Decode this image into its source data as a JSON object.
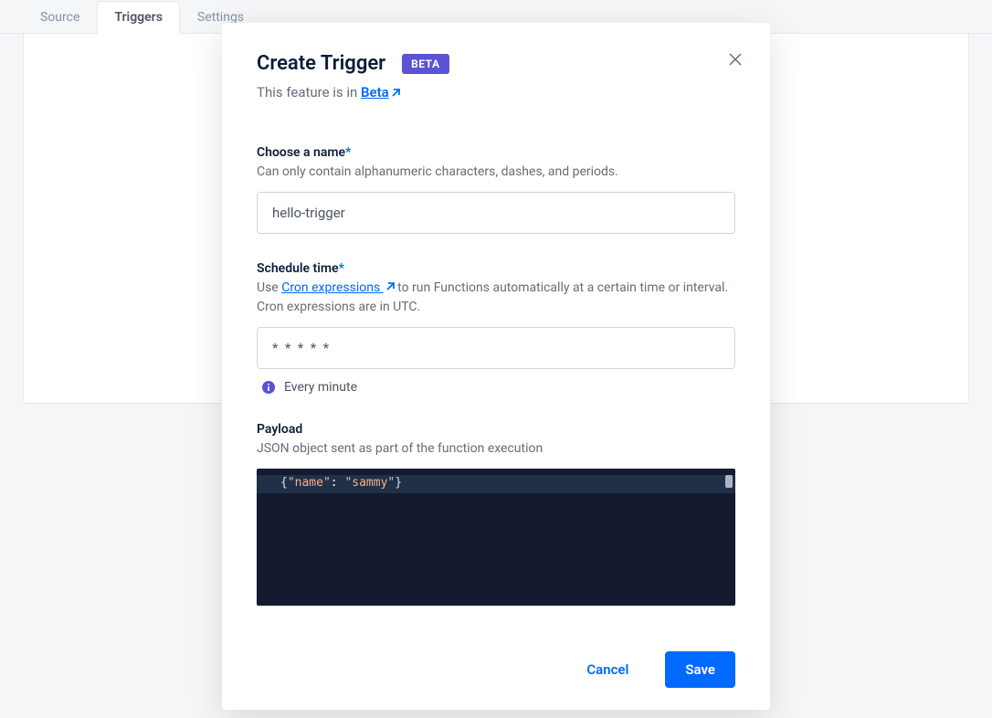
{
  "tabs": {
    "source": "Source",
    "triggers": "Triggers",
    "settings": "Settings"
  },
  "modal": {
    "title": "Create Trigger",
    "badge": "BETA",
    "subtitle_prefix": "This feature is in ",
    "subtitle_link": "Beta",
    "name_field": {
      "label": "Choose a name",
      "help": "Can only contain alphanumeric characters, dashes, and periods.",
      "value": "hello-trigger"
    },
    "schedule_field": {
      "label": "Schedule time",
      "help_prefix": "Use ",
      "help_link": "Cron expressions ",
      "help_suffix": " to run Functions automatically at a certain time or interval. Cron expressions are in UTC.",
      "value": "*  *  *  *  *",
      "hint": "Every minute"
    },
    "payload_field": {
      "label": "Payload",
      "help": "JSON object sent as part of the function execution",
      "code_key": "\"name\"",
      "code_value": "\"sammy\""
    },
    "footer": {
      "cancel": "Cancel",
      "save": "Save"
    }
  }
}
